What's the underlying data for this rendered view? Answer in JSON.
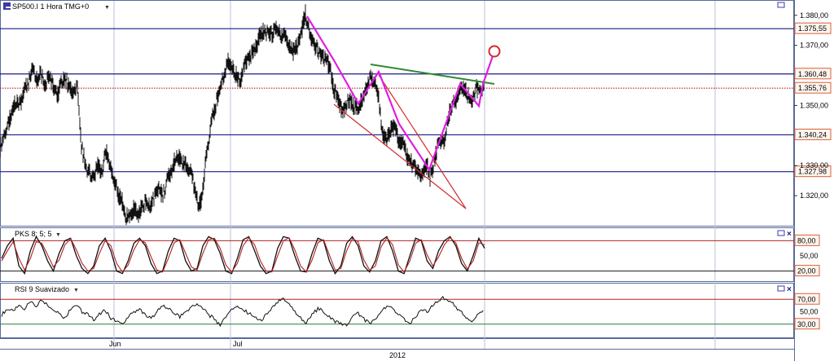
{
  "main_panel": {
    "title": "SP500.I 1 Hora TMG+0",
    "dropdown_icon": "chevron-down-icon",
    "axis_ticks": [
      "1.380,00",
      "1.370,00",
      "1.350,00",
      "1.330,00",
      "1.320,00"
    ],
    "hlines": [
      {
        "label": "1.375,55",
        "value": 1375.55,
        "color": "#1a1a8c",
        "style": "solid"
      },
      {
        "label": "1.360,48",
        "value": 1360.48,
        "color": "#1a1a8c",
        "style": "solid"
      },
      {
        "label": "1.355,76",
        "value": 1355.76,
        "color": "#b22222",
        "style": "dotted"
      },
      {
        "label": "1.340,24",
        "value": 1340.24,
        "color": "#1a1a8c",
        "style": "solid"
      },
      {
        "label": "1.327,98",
        "value": 1327.98,
        "color": "#1a1a8c",
        "style": "solid"
      }
    ]
  },
  "pks_panel": {
    "title": "PKS 8; 5; 5",
    "axis_ticks": [
      "50,00"
    ],
    "hlines": [
      {
        "label": "80,00",
        "value": 80,
        "color": "#b22222"
      },
      {
        "label": "20,00",
        "value": 20,
        "color": "#1a1a1a"
      }
    ]
  },
  "rsi_panel": {
    "title": "RSI 9 Suavizado",
    "axis_ticks": [
      "50,00"
    ],
    "hlines": [
      {
        "label": "70,00",
        "value": 70,
        "color": "#b22222"
      },
      {
        "label": "30,00",
        "value": 30,
        "color": "#2e7d32"
      }
    ]
  },
  "x_axis": {
    "months": [
      "Jun",
      "Jul"
    ],
    "year": "2012"
  },
  "panel_controls": {
    "window_icon": "window-icon",
    "close_icon": "close-icon"
  },
  "colors": {
    "pattern": "#e01ee0",
    "resistance": "#2e8b2e",
    "wedge": "#d42a2a",
    "target": "#d42a2a",
    "price": "#111111",
    "panel_line": "#1a1a8c"
  },
  "chart_data": [
    {
      "type": "line",
      "title": "SP500.I 1 Hora TMG+0",
      "ylim": [
        1310,
        1384
      ],
      "x": [
        0,
        5,
        10,
        15,
        20,
        25,
        30,
        35,
        40,
        43,
        46,
        50,
        55,
        60,
        65,
        70,
        75,
        80,
        85,
        90,
        95,
        98,
        100,
        103,
        106,
        110,
        115,
        120,
        125,
        130,
        135,
        140,
        145,
        150,
        155,
        158,
        160,
        165,
        170,
        175,
        180,
        185,
        190,
        195,
        200,
        205,
        210,
        215,
        220,
        225,
        230,
        235,
        240,
        244,
        248,
        252,
        256,
        260,
        265,
        270,
        275,
        280,
        285,
        290,
        295,
        300,
        305,
        310,
        315,
        320,
        325,
        330,
        335,
        340,
        345,
        350,
        355,
        360,
        365,
        370,
        375,
        377,
        380,
        385,
        390,
        395,
        400,
        405,
        410,
        415,
        420,
        425,
        430,
        435,
        440,
        445,
        450,
        455,
        460,
        465,
        470,
        475,
        480,
        485,
        490,
        495,
        500,
        505,
        510,
        515,
        520,
        525,
        528,
        532,
        536,
        540,
        545,
        550,
        555,
        560,
        565,
        570,
        575,
        580,
        585,
        588,
        592,
        595
      ],
      "values": [
        1336,
        1340,
        1344,
        1348,
        1352,
        1350,
        1355,
        1358,
        1362,
        1360,
        1358,
        1361,
        1356,
        1360,
        1357,
        1353,
        1357,
        1359,
        1356,
        1353,
        1357,
        1345,
        1336,
        1333,
        1328,
        1328,
        1326,
        1330,
        1328,
        1335,
        1330,
        1326,
        1320,
        1318,
        1313,
        1313,
        1314,
        1316,
        1314,
        1317,
        1318,
        1316,
        1320,
        1322,
        1320,
        1325,
        1328,
        1332,
        1333,
        1331,
        1330,
        1327,
        1321,
        1316,
        1319,
        1330,
        1338,
        1345,
        1350,
        1356,
        1360,
        1365,
        1363,
        1360,
        1358,
        1363,
        1365,
        1368,
        1370,
        1374,
        1375,
        1373,
        1374,
        1376,
        1373,
        1374,
        1370,
        1368,
        1370,
        1374,
        1381,
        1378,
        1374,
        1370,
        1369,
        1366,
        1365,
        1363,
        1355,
        1352,
        1348,
        1350,
        1352,
        1349,
        1350,
        1352,
        1356,
        1360,
        1358,
        1352,
        1340,
        1339,
        1342,
        1343,
        1337,
        1338,
        1333,
        1331,
        1329,
        1327,
        1328,
        1330,
        1326,
        1330,
        1335,
        1338,
        1337,
        1346,
        1350,
        1352,
        1355,
        1356,
        1353,
        1352,
        1356,
        1354,
        1356,
        1357
      ],
      "xlabel": "",
      "ylabel": ""
    },
    {
      "type": "line",
      "title": "PKS 8; 5; 5",
      "ylim": [
        0,
        100
      ],
      "series": [
        {
          "color": "#111111",
          "values": [
            45,
            70,
            85,
            30,
            15,
            60,
            88,
            70,
            40,
            20,
            55,
            80,
            85,
            50,
            25,
            15,
            30,
            70,
            85,
            60,
            20,
            15,
            40,
            75,
            85,
            70,
            35,
            15,
            20,
            60,
            85,
            80,
            40,
            20,
            25,
            70,
            88,
            82,
            55,
            20,
            15,
            45,
            82,
            88,
            60,
            30,
            15,
            20,
            65,
            88,
            85,
            50,
            20,
            18,
            55,
            85,
            80,
            40,
            15,
            30,
            75,
            88,
            70,
            30,
            18,
            40,
            80,
            88,
            60,
            20,
            15,
            50,
            85,
            80,
            40,
            25,
            60,
            80,
            88,
            70,
            35,
            20,
            50,
            85,
            65
          ]
        },
        {
          "color": "#b22222",
          "values": [
            40,
            60,
            78,
            45,
            22,
            45,
            78,
            75,
            52,
            28,
            42,
            72,
            84,
            62,
            35,
            20,
            25,
            55,
            80,
            70,
            35,
            18,
            32,
            62,
            82,
            76,
            48,
            22,
            18,
            45,
            76,
            82,
            55,
            28,
            22,
            55,
            82,
            85,
            65,
            32,
            18,
            35,
            70,
            86,
            72,
            40,
            20,
            18,
            50,
            80,
            86,
            62,
            30,
            18,
            42,
            76,
            82,
            52,
            22,
            25,
            60,
            84,
            78,
            42,
            22,
            30,
            68,
            86,
            72,
            32,
            18,
            40,
            75,
            82,
            52,
            30,
            48,
            72,
            86,
            76,
            45,
            24,
            40,
            76,
            72
          ]
        }
      ]
    },
    {
      "type": "line",
      "title": "RSI 9 Suavizado",
      "ylim": [
        10,
        90
      ],
      "values": [
        45,
        55,
        50,
        60,
        55,
        65,
        58,
        70,
        60,
        55,
        48,
        40,
        55,
        62,
        50,
        45,
        38,
        45,
        52,
        40,
        35,
        28,
        40,
        50,
        55,
        45,
        38,
        52,
        60,
        55,
        48,
        42,
        50,
        58,
        62,
        55,
        45,
        38,
        30,
        42,
        55,
        60,
        52,
        48,
        40,
        35,
        45,
        55,
        65,
        70,
        62,
        50,
        40,
        32,
        45,
        55,
        50,
        42,
        35,
        30,
        28,
        40,
        48,
        38,
        32,
        38,
        50,
        58,
        55,
        45,
        38,
        30,
        42,
        52,
        50,
        60,
        70,
        72,
        68,
        58,
        48,
        40,
        35,
        48,
        55
      ]
    }
  ]
}
